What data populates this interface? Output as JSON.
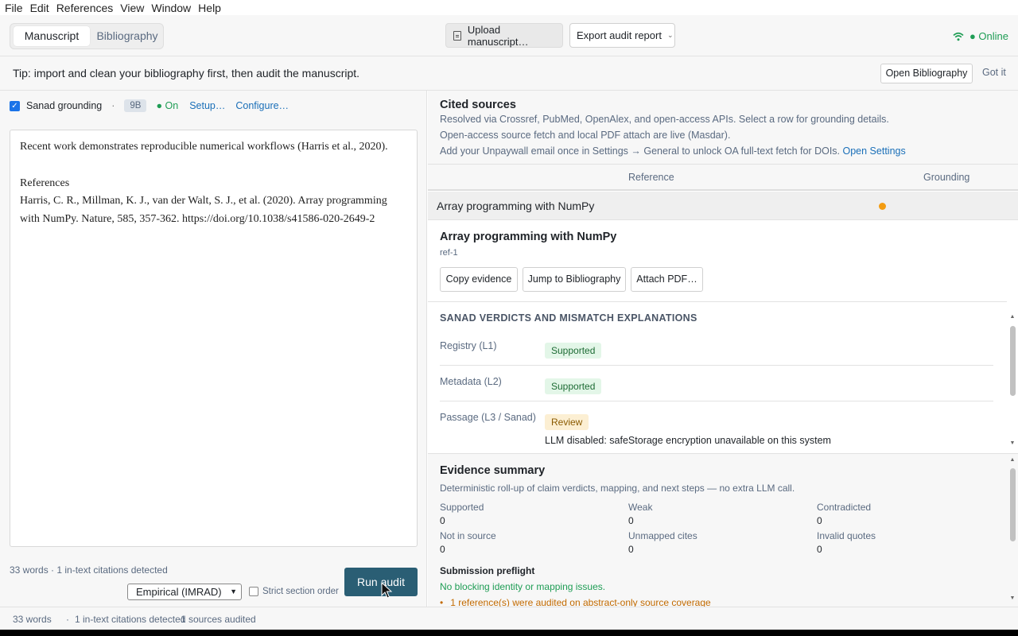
{
  "menu": [
    "File",
    "Edit",
    "References",
    "View",
    "Window",
    "Help"
  ],
  "header": {
    "tabs": [
      "Manuscript",
      "Bibliography"
    ],
    "upload_label": "Upload manuscript…",
    "export_label": "Export audit report",
    "status": "● Online"
  },
  "tip": {
    "text": "Tip: import and clean your bibliography first, then audit the manuscript.",
    "open_bib_label": "Open Bibliography",
    "dismiss_label": "Got it"
  },
  "grounding": {
    "label": "Sanad grounding",
    "separator": "·",
    "model_badge": "9B",
    "state": "● On",
    "setup_label": "Setup…",
    "configure_label": "Configure…",
    "checked": true
  },
  "manuscript": {
    "line1": "Recent work demonstrates reproducible numerical workflows (Harris et al., 2020).",
    "references_heading": "References",
    "reference_text": "Harris, C. R., Millman, K. J., van der Walt, S. J., et al. (2020). Array programming with NumPy. Nature, 585, 357-362. https://doi.org/10.1038/s41586-020-2649-2"
  },
  "controls": {
    "stats": "33 words · 1 in-text citations detected",
    "template": "Empirical (IMRAD)",
    "strict_label": "Strict section order",
    "run_label": "Run audit"
  },
  "cited": {
    "title": "Cited sources",
    "line1": "Resolved via Crossref, PubMed, OpenAlex, and open-access APIs. Select a row for grounding details.",
    "line2": "Open-access source fetch and local PDF attach are live (Masdar).",
    "line3": "Add your Unpaywall email once in Settings → General to unlock OA full-text fetch for DOIs.",
    "open_settings": "Open Settings",
    "col_reference": "Reference",
    "col_grounding": "Grounding",
    "rows": [
      {
        "title": "Array programming with NumPy",
        "grounding_color": "#f39c12"
      }
    ]
  },
  "detail": {
    "title": "Array programming with NumPy",
    "ref_id": "ref-1",
    "btn_copy": "Copy evidence",
    "btn_jump": "Jump to Bibliography",
    "btn_attach": "Attach PDF…",
    "verdicts_heading": "SANAD VERDICTS AND MISMATCH EXPLANATIONS",
    "verdicts": [
      {
        "key": "Registry (L1)",
        "value": "Supported"
      },
      {
        "key": "Metadata (L2)",
        "value": "Supported"
      },
      {
        "key": "Passage (L3 / Sanad)",
        "value": "Review"
      }
    ],
    "passage_note": "LLM disabled: safeStorage encryption unavailable on this system"
  },
  "evidence": {
    "title": "Evidence summary",
    "subtitle": "Deterministic roll-up of claim verdicts, mapping, and next steps — no extra LLM call.",
    "stats": [
      {
        "label": "Supported",
        "value": "0"
      },
      {
        "label": "Weak",
        "value": "0"
      },
      {
        "label": "Contradicted",
        "value": "0"
      },
      {
        "label": "Not in source",
        "value": "0"
      },
      {
        "label": "Unmapped cites",
        "value": "0"
      },
      {
        "label": "Invalid quotes",
        "value": "0"
      }
    ],
    "preflight_title": "Submission preflight",
    "preflight_ok": "No blocking identity or mapping issues.",
    "preflight_warning": "1 reference(s) were audited on abstract-only source coverage"
  },
  "statusbar": {
    "words": "33 words",
    "citations": "1 in-text citations detected",
    "audited": "1 sources audited"
  },
  "colors": {
    "accent": "#2a5e74",
    "link": "#1a6fb8",
    "online": "#1f9d55",
    "warning": "#f39c12"
  }
}
